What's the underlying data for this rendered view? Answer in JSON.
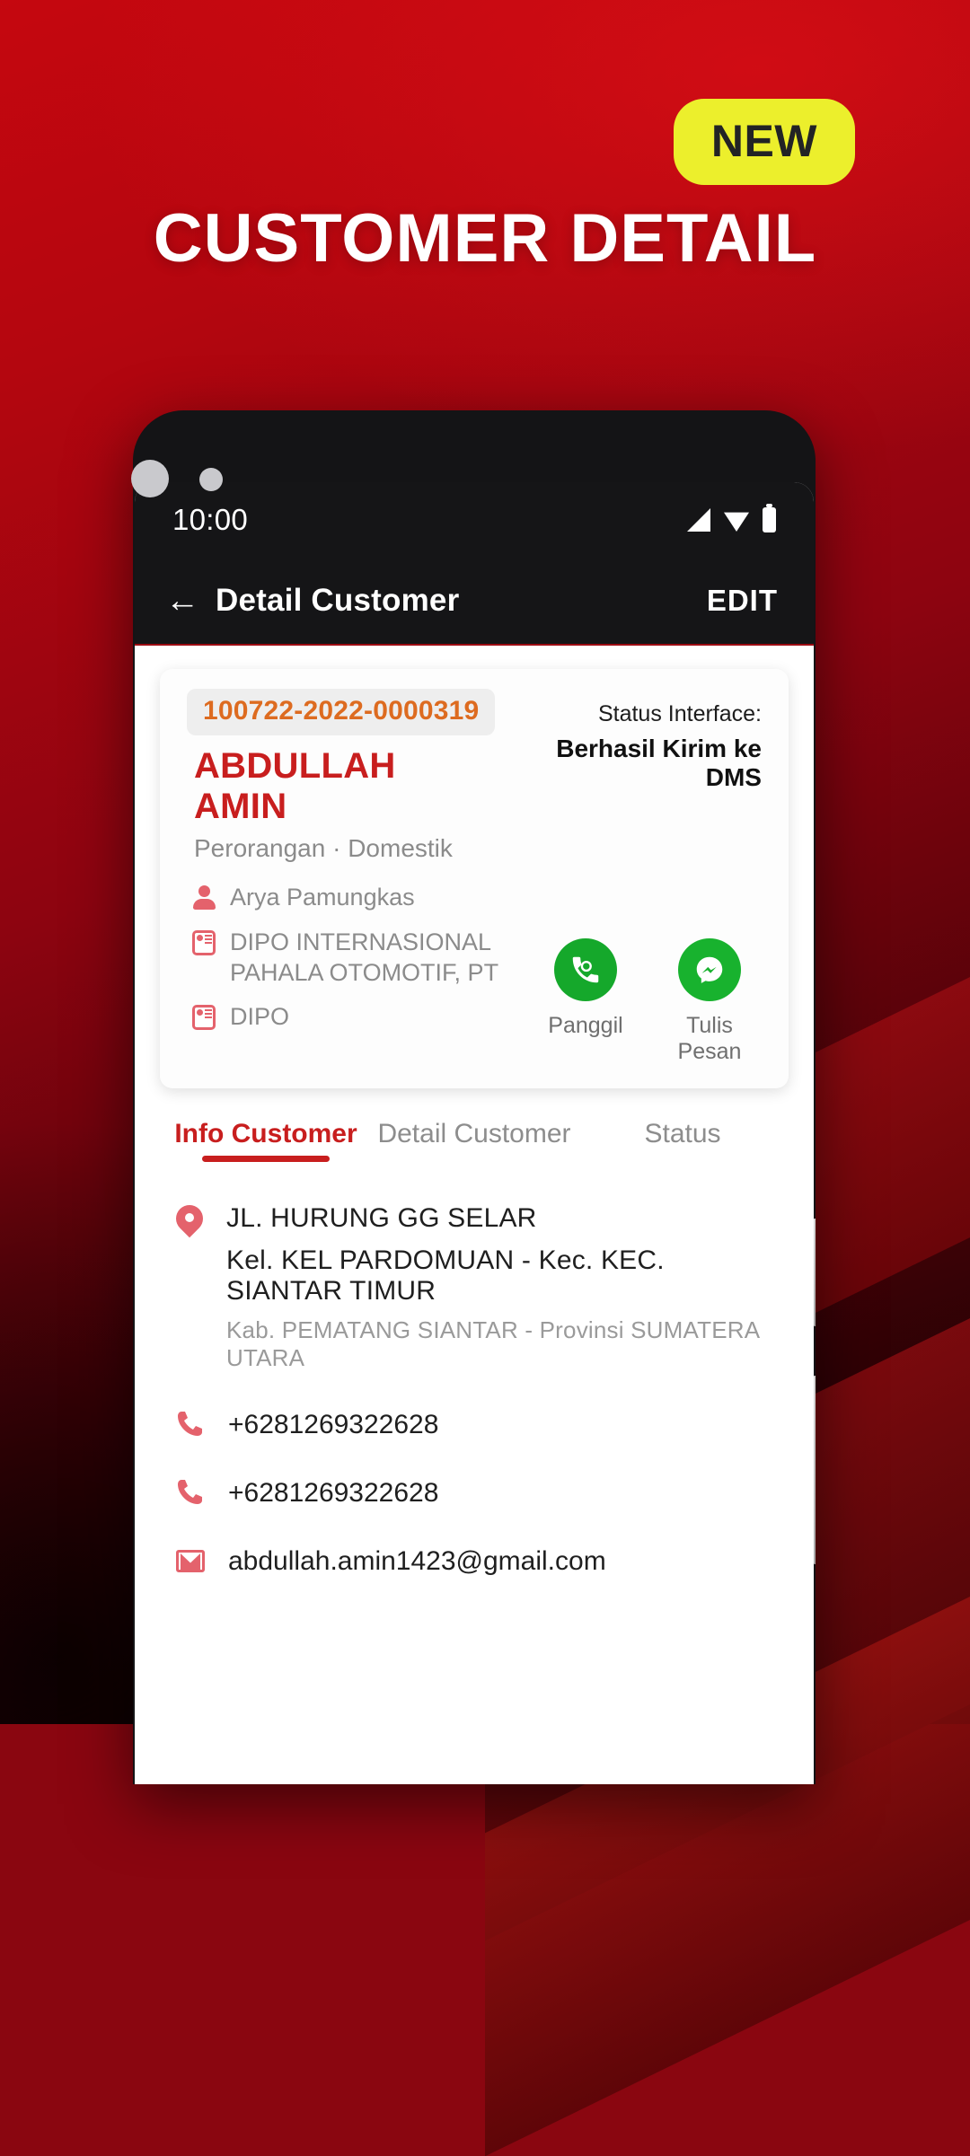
{
  "hero": {
    "badge": "NEW",
    "title": "CUSTOMER DETAIL",
    "badge_color": "#ecef2c",
    "badge_text_color": "#222325",
    "title_color": "#ffffff",
    "background_color": "#b4060f"
  },
  "phone": {
    "statusbar": {
      "time": "10:00",
      "icons": [
        "signal-icon",
        "wifi-icon",
        "battery-icon"
      ]
    },
    "appbar": {
      "back": "←",
      "title": "Detail Customer",
      "action": "EDIT"
    }
  },
  "card": {
    "customer_id": "100722-2022-0000319",
    "name": "ABDULLAH AMIN",
    "subtitle": "Perorangan · Domestik",
    "status_label": "Status Interface:",
    "status_value": "Berhasil Kirim ke DMS",
    "meta": [
      {
        "icon": "person-icon",
        "text": "Arya Pamungkas"
      },
      {
        "icon": "id-card-icon",
        "text": "DIPO INTERNASIONAL PAHALA OTOMOTIF, PT"
      },
      {
        "icon": "id-card-icon",
        "text": "DIPO"
      }
    ],
    "actions": [
      {
        "icon": "phone-call-icon",
        "label": "Panggil",
        "color": "#15a82b"
      },
      {
        "icon": "messenger-icon",
        "label": "Tulis Pesan",
        "color": "#18b22e"
      }
    ],
    "id_color": "#dd6b20",
    "name_color": "#c81e1e"
  },
  "tabs": [
    {
      "label": "Info Customer",
      "active": true
    },
    {
      "label": "Detail Customer",
      "active": false
    },
    {
      "label": "Status",
      "active": false
    }
  ],
  "info": {
    "address": {
      "icon": "location-pin-icon",
      "line1": "JL. HURUNG GG SELAR",
      "line2": "Kel. KEL PARDOMUAN - Kec. KEC. SIANTAR  TIMUR",
      "line3": "Kab. PEMATANG SIANTAR - Provinsi SUMATERA UTARA"
    },
    "phone1": {
      "icon": "phone-icon",
      "text": "+6281269322628"
    },
    "phone2": {
      "icon": "phone-icon",
      "text": "+6281269322628"
    },
    "email": {
      "icon": "gmail-icon",
      "text": "abdullah.amin1423@gmail.com"
    }
  }
}
